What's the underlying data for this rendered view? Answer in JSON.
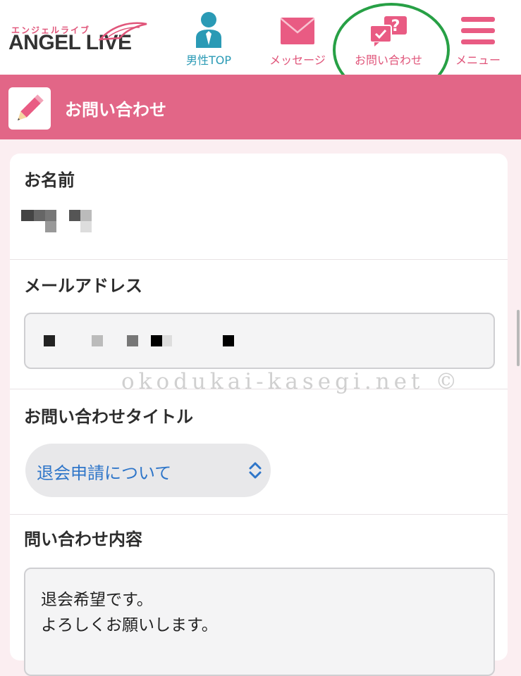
{
  "header": {
    "logo_kana": "エンジェルライブ",
    "logo_text": "ANGEL LIVE",
    "nav": [
      {
        "label": "男性TOP",
        "icon": "male-user-icon",
        "color": "#2a9ab5"
      },
      {
        "label": "メッセージ",
        "icon": "mail-icon",
        "color": "#e0557a"
      },
      {
        "label": "お問い合わせ",
        "icon": "inquiry-chat-icon",
        "color": "#e0557a"
      },
      {
        "label": "メニュー",
        "icon": "hamburger-menu-icon",
        "color": "#e0557a"
      }
    ]
  },
  "page": {
    "title": "お問い合わせ",
    "title_icon": "pencil-icon"
  },
  "form": {
    "name_label": "お名前",
    "email_label": "メールアドレス",
    "subject_label": "お問い合わせタイトル",
    "subject_value": "退会申請について",
    "content_label": "問い合わせ内容",
    "content_value": "退会希望です。\nよろしくお願いします。"
  },
  "watermark": "okodukai-kasegi.net ©",
  "colors": {
    "accent": "#e26687",
    "link_blue": "#2f76c9",
    "highlight_circle": "#27a045"
  }
}
